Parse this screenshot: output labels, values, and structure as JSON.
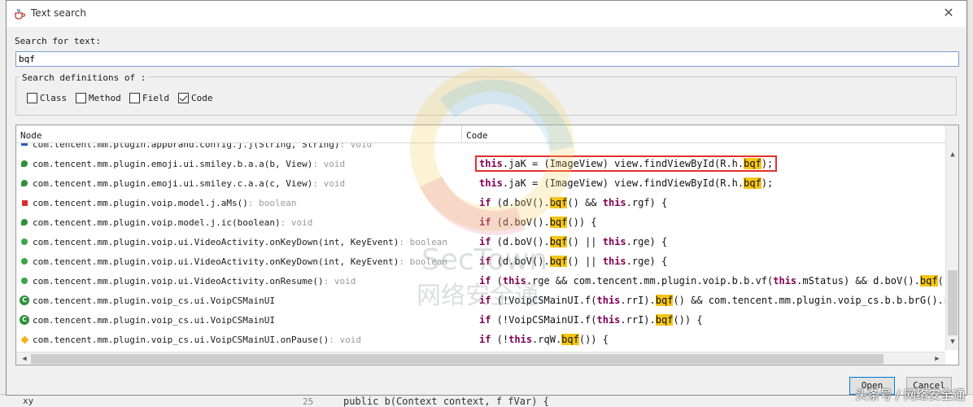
{
  "dialog": {
    "title": "Text search",
    "search_label": "Search for text:",
    "search_value": "bqf",
    "definitions_label": "Search definitions of :",
    "checkboxes": [
      {
        "label": "Class",
        "checked": false
      },
      {
        "label": "Method",
        "checked": false
      },
      {
        "label": "Field",
        "checked": false
      },
      {
        "label": "Code",
        "checked": true
      }
    ],
    "columns": {
      "node": "Node",
      "code": "Code"
    },
    "buttons": {
      "open": "Open",
      "cancel": "Cancel"
    }
  },
  "nodes": [
    {
      "icon": "method-blue-icon",
      "name": "com.tencent.mm.plugin.appbrand.config.j.j(String, String)",
      "sig": " : void"
    },
    {
      "icon": "constructor-icon",
      "name": "com.tencent.mm.plugin.emoji.ui.smiley.b.a.a(b, View)",
      "sig": " : void"
    },
    {
      "icon": "constructor-icon",
      "name": "com.tencent.mm.plugin.emoji.ui.smiley.c.a.a(c, View)",
      "sig": " : void"
    },
    {
      "icon": "private-method-icon",
      "name": "com.tencent.mm.plugin.voip.model.j.aMs()",
      "sig": " : boolean"
    },
    {
      "icon": "constructor-icon",
      "name": "com.tencent.mm.plugin.voip.model.j.ic(boolean)",
      "sig": " : void"
    },
    {
      "icon": "public-method-icon",
      "name": "com.tencent.mm.plugin.voip.ui.VideoActivity.onKeyDown(int, KeyEvent)",
      "sig": " : boolean"
    },
    {
      "icon": "public-method-icon",
      "name": "com.tencent.mm.plugin.voip.ui.VideoActivity.onKeyDown(int, KeyEvent)",
      "sig": " : boolean"
    },
    {
      "icon": "public-method-icon",
      "name": "com.tencent.mm.plugin.voip.ui.VideoActivity.onResume()",
      "sig": " : void"
    },
    {
      "icon": "class-icon",
      "name": "com.tencent.mm.plugin.voip_cs.ui.VoipCSMainUI",
      "sig": ""
    },
    {
      "icon": "class-icon",
      "name": "com.tencent.mm.plugin.voip_cs.ui.VoipCSMainUI",
      "sig": ""
    },
    {
      "icon": "protected-method-icon",
      "name": "com.tencent.mm.plugin.voip_cs.ui.VoipCSMainUI.onPause()",
      "sig": " : void"
    }
  ],
  "code_lines": [
    "this.jaK = (ImageView) view.findViewById(R.h.bqf);",
    "this.jaK = (ImageView) view.findViewById(R.h.bqf);",
    "if (d.boV().bqf() && this.rgf) {",
    "if (d.boV().bqf()) {",
    "if (d.boV().bqf() || this.rge) {",
    "if (d.boV().bqf() || this.rge) {",
    "if (this.rge && com.tencent.mm.plugin.voip.b.b.vf(this.mStatus) && d.boV().bqf()) {",
    "if (!VoipCSMainUI.f(this.rrI).bqf() && com.tencent.mm.plugin.voip_cs.b.b.brG().rqQ",
    "if (!VoipCSMainUI.f(this.rrI).bqf()) {",
    "if (!this.rqW.bqf()) {"
  ],
  "background_editor": {
    "line_number": "25",
    "code_fragment": "public b(Context context, f fVar) {",
    "left_text": "xy"
  },
  "watermark": {
    "brand": "SecTown",
    "subtitle": "网络安全通",
    "corner": "头条号 / 网络安全通"
  },
  "colors": {
    "keyword": "#7f0055",
    "highlight": "#f5c518",
    "outline": "#e0302c"
  }
}
